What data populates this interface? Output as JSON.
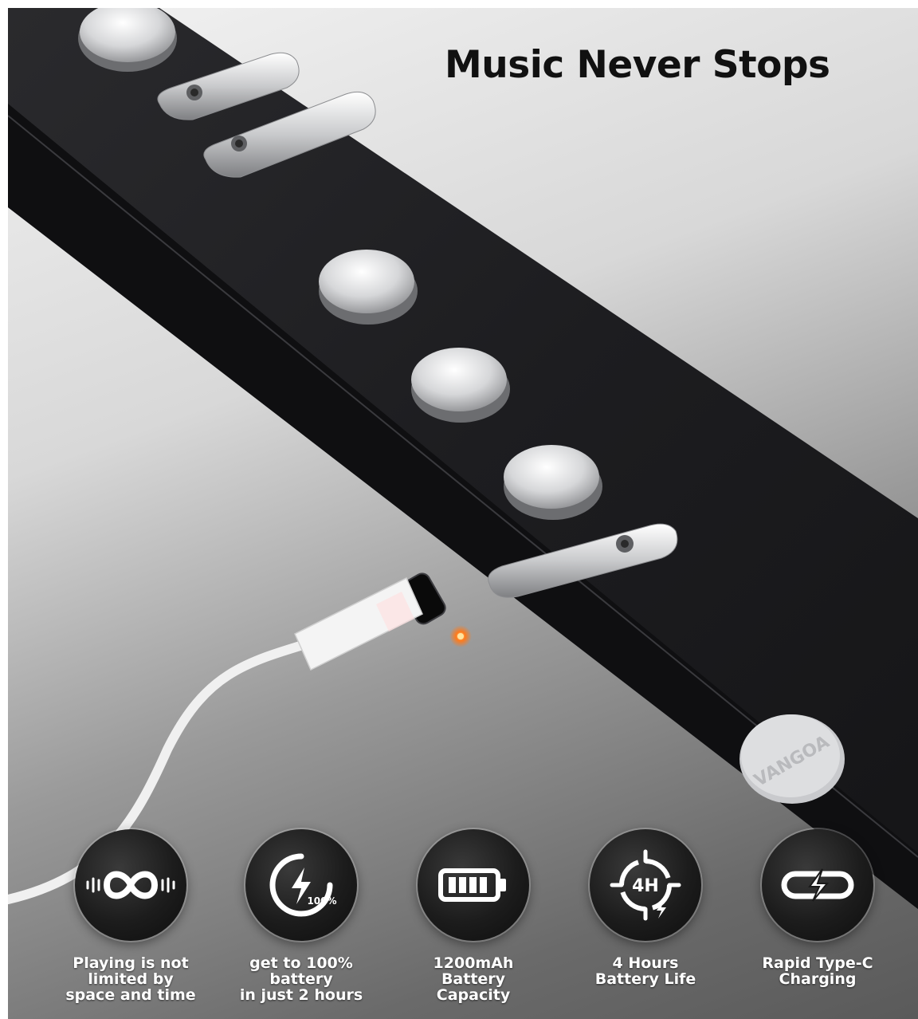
{
  "headline": "Music Never Stops",
  "brand_mark": "VANGOA",
  "features": [
    {
      "icon": "infinity-wave-icon",
      "label": "Playing is not\nlimited by\nspace and time"
    },
    {
      "icon": "charging-bolt-icon",
      "badge": "100%",
      "label": "get to 100%\nbattery\nin just 2 hours"
    },
    {
      "icon": "battery-icon",
      "label": "1200mAh\nBattery\nCapacity"
    },
    {
      "icon": "four-hour-clock-icon",
      "badge": "4H",
      "label": "4 Hours\nBattery Life"
    },
    {
      "icon": "type-c-plug-icon",
      "label": "Rapid Type-C\nCharging"
    }
  ],
  "colors": {
    "body": "#1f1f22",
    "metal": "#d9dadc",
    "cable": "#f4f4f4",
    "led": "#ff6a1a"
  }
}
